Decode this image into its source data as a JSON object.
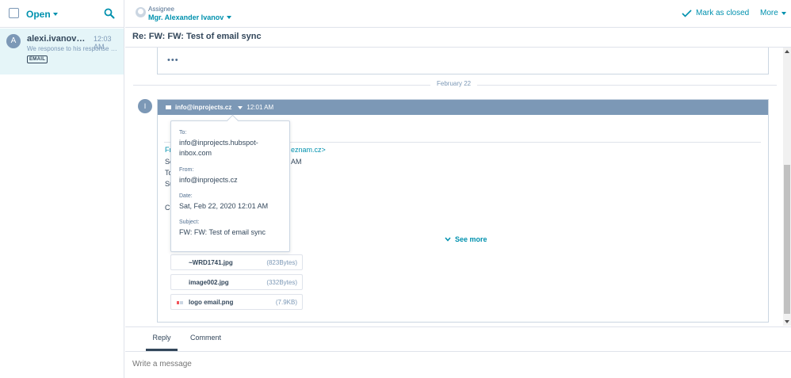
{
  "sidebar": {
    "filter_label": "Open",
    "conversations": [
      {
        "avatar": "A",
        "from": "alexi.ivanov@seznam.cz",
        "time": "12:03 AM",
        "preview": "We response to his response and ...",
        "badge": "EMAIL"
      }
    ]
  },
  "topbar": {
    "assignee_label": "Assignee",
    "assignee_name": "Mgr. Alexander Ivanov",
    "mark_closed": "Mark as closed",
    "more": "More"
  },
  "thread": {
    "subject": "Re: FW: FW: Test of email sync",
    "collapsed_dots": "•••",
    "date_divider": "February 22",
    "message": {
      "avatar": "I",
      "from": "info@inprojects.cz",
      "time": "12:01 AM",
      "body_lines": [
        "Fr",
        "Se",
        "To",
        "Su",
        "C"
      ],
      "partial_link": "eznam.cz>",
      "partial_time": "AM",
      "see_more": "See more",
      "attachments": [
        {
          "name": "~WRD1741.jpg",
          "size": "(823Bytes)"
        },
        {
          "name": "image002.jpg",
          "size": "(332Bytes)"
        },
        {
          "name": "logo email.png",
          "size": "(7.9KB)"
        }
      ]
    },
    "popover": {
      "to_label": "To:",
      "to_value": "info@inprojects.hubspot-inbox.com",
      "from_label": "From:",
      "from_value": "info@inprojects.cz",
      "date_label": "Date:",
      "date_value": "Sat, Feb 22, 2020 12:01 AM",
      "subject_label": "Subject:",
      "subject_value": "FW: FW: Test of email sync"
    }
  },
  "composer": {
    "tabs": [
      "Reply",
      "Comment"
    ],
    "placeholder": "Write a message"
  },
  "colors": {
    "accent": "#0091ae",
    "header_bar": "#7c98b6",
    "selected_row": "#e5f5f8",
    "text": "#33475b"
  }
}
